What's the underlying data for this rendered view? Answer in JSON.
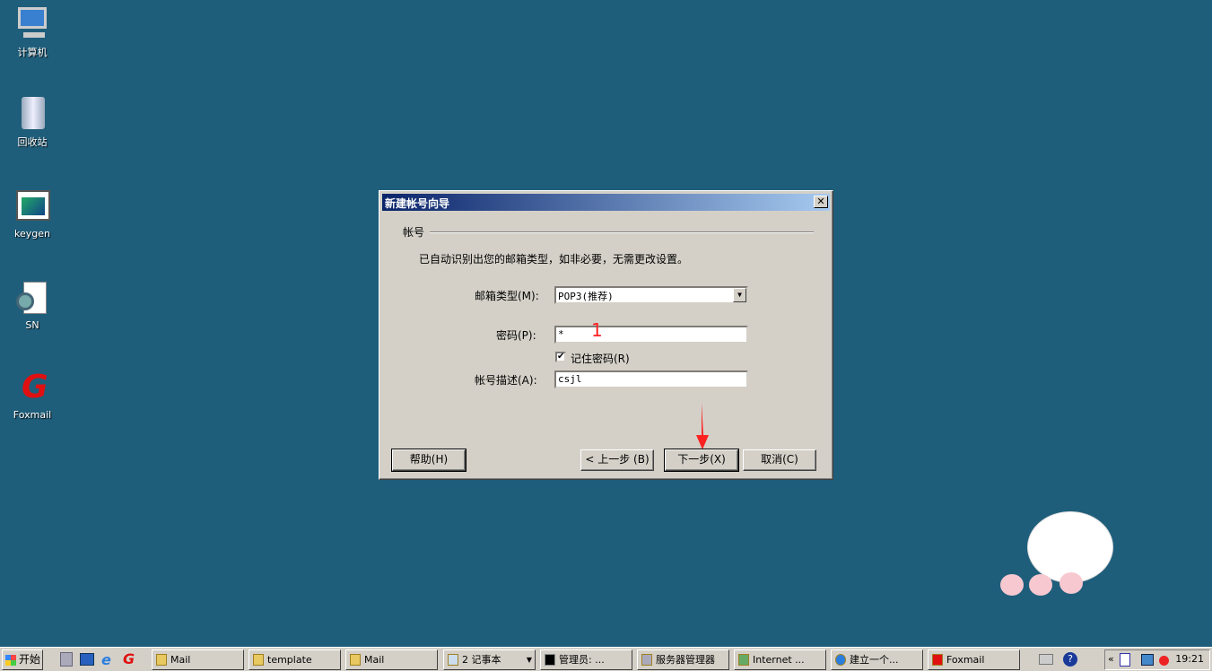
{
  "desktop": {
    "icons": [
      {
        "label": "计算机",
        "icon": "computer-icon"
      },
      {
        "label": "回收站",
        "icon": "recycle-bin-icon"
      },
      {
        "label": "keygen",
        "icon": "app-window-icon"
      },
      {
        "label": "SN",
        "icon": "settings-file-icon"
      },
      {
        "label": "Foxmail",
        "icon": "foxmail-shortcut-icon"
      }
    ]
  },
  "dialog": {
    "title": "新建帐号向导",
    "close": "✕",
    "section": "帐号",
    "hint": "已自动识别出您的邮箱类型，如非必要，无需更改设置。",
    "mailbox_type_label": "邮箱类型(M):",
    "mailbox_type_value": "POP3(推荐)",
    "password_label": "密码(P):",
    "password_value": "*",
    "remember_label": "记住密码(R)",
    "remember_checked": true,
    "desc_label": "帐号描述(A):",
    "desc_value": "csjl",
    "help": "帮助(H)",
    "back": "< 上一步 (B)",
    "next": "下一步(X)",
    "cancel": "取消(C)"
  },
  "annotation": {
    "number": "1",
    "color": "#ff2020"
  },
  "taskbar": {
    "start": "开始",
    "tasks": [
      "Mail",
      "template",
      "Mail",
      "2 记事本",
      "管理员: ...",
      "服务器管理器",
      "Internet ...",
      "建立一个...",
      "Foxmail"
    ],
    "clock": "19:21"
  }
}
